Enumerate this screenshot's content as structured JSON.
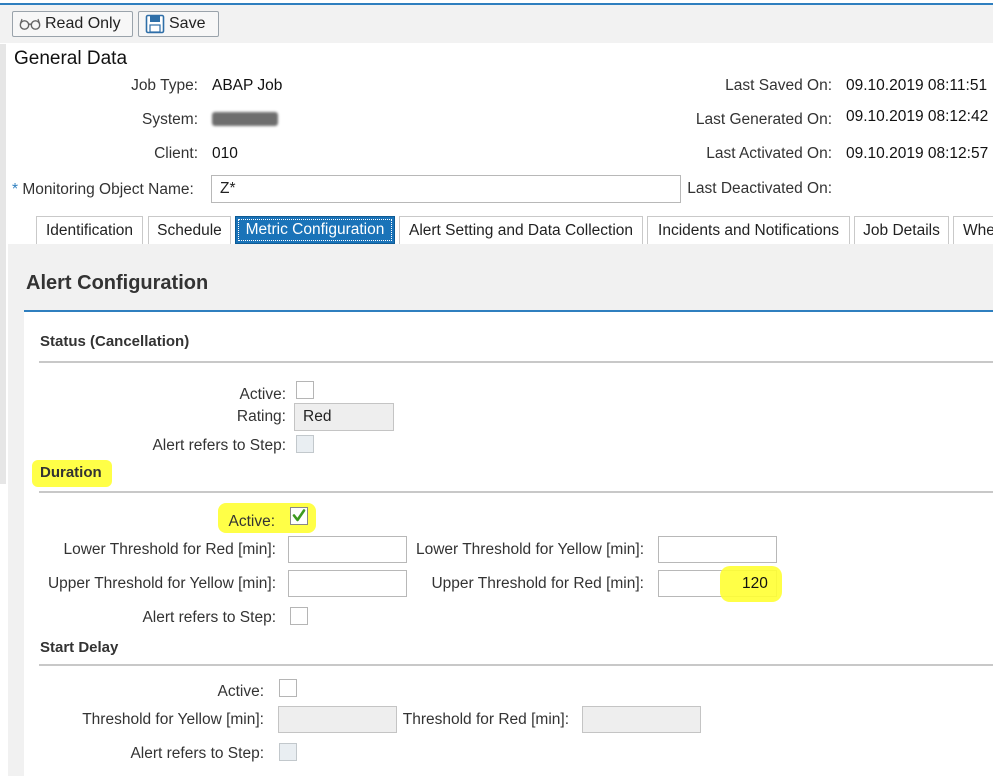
{
  "toolbar": {
    "read_only_label": "Read Only",
    "save_label": "Save"
  },
  "general": {
    "title": "General Data",
    "job_type_label": "Job Type:",
    "job_type_value": "ABAP Job",
    "system_label": "System:",
    "client_label": "Client:",
    "client_value": "010",
    "monitoring_label": "Monitoring Object Name:",
    "monitoring_required": "*",
    "monitoring_value": "Z*",
    "last_saved_label": "Last Saved On:",
    "last_saved_value": "09.10.2019 08:11:51",
    "last_generated_label": "Last Generated On:",
    "last_generated_value": "09.10.2019 08:12:42",
    "last_activated_label": "Last Activated On:",
    "last_activated_value": "09.10.2019 08:12:57",
    "last_deactivated_label": "Last Deactivated On:"
  },
  "tabs": [
    {
      "label": "Identification"
    },
    {
      "label": "Schedule"
    },
    {
      "label": "Metric Configuration",
      "active": true
    },
    {
      "label": "Alert Setting and Data Collection"
    },
    {
      "label": "Incidents and Notifications"
    },
    {
      "label": "Job Details"
    },
    {
      "label": "Whe"
    }
  ],
  "alert_config": {
    "title": "Alert Configuration",
    "status": {
      "title": "Status (Cancellation)",
      "active_label": "Active:",
      "rating_label": "Rating:",
      "rating_value": "Red",
      "alert_step_label": "Alert refers to Step:"
    },
    "duration": {
      "title": "Duration",
      "active_label": "Active:",
      "active_checked": true,
      "lower_red_label": "Lower Threshold for Red [min]:",
      "lower_red_value": "",
      "lower_yellow_label": "Lower Threshold for Yellow [min]:",
      "lower_yellow_value": "",
      "upper_yellow_label": "Upper Threshold for Yellow [min]:",
      "upper_yellow_value": "",
      "upper_red_label": "Upper Threshold for Red [min]:",
      "upper_red_value": "120",
      "alert_step_label": "Alert refers to Step:"
    },
    "start_delay": {
      "title": "Start Delay",
      "active_label": "Active:",
      "yellow_label": "Threshold for Yellow [min]:",
      "yellow_value": "",
      "red_label": "Threshold for Red [min]:",
      "red_value": "",
      "alert_step_label": "Alert refers to Step:"
    }
  },
  "colors": {
    "accent": "#2f7fbf",
    "active_tab": "#1a73b8",
    "highlight": "#ffff33",
    "check": "#3d9a1f"
  }
}
